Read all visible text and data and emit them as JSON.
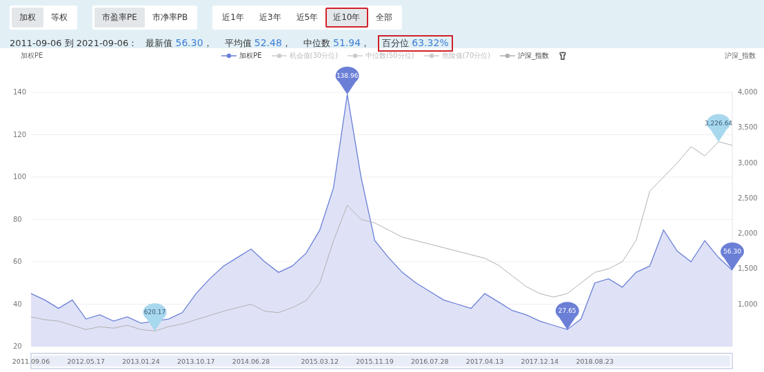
{
  "weight_tabs": [
    {
      "label": "加权",
      "selected": true
    },
    {
      "label": "等权",
      "selected": false
    }
  ],
  "metric_tabs": [
    {
      "label": "市盈率PE",
      "selected": true
    },
    {
      "label": "市净率PB",
      "selected": false
    }
  ],
  "period_tabs": [
    {
      "label": "近1年",
      "selected": false
    },
    {
      "label": "近3年",
      "selected": false
    },
    {
      "label": "近5年",
      "selected": false
    },
    {
      "label": "近10年",
      "selected": true
    },
    {
      "label": "全部",
      "selected": false
    }
  ],
  "summary": {
    "range": "2011-09-06 到 2021-09-06：",
    "stats": [
      {
        "label": "最新值",
        "value": "56.30",
        "sep": "，",
        "highlighted": false
      },
      {
        "label": "平均值",
        "value": "52.48",
        "sep": "，",
        "highlighted": false
      },
      {
        "label": "中位数",
        "value": "51.94",
        "sep": "，",
        "highlighted": false
      },
      {
        "label": "百分位",
        "value": "63.32%",
        "highlighted": true
      }
    ]
  },
  "chart": {
    "left_axis_title": "加权PE",
    "right_axis_title": "沪深_指数",
    "legend": [
      {
        "kind": "series",
        "selected": true
      },
      {
        "kind": "level",
        "label": "机会值(30分位)",
        "selected": false
      },
      {
        "kind": "level",
        "label": "中位数(50分位)",
        "selected": false
      },
      {
        "kind": "level",
        "label": "危险值(70分位)",
        "selected": false
      },
      {
        "kind": "series",
        "selected": true
      }
    ],
    "markers": [
      {
        "kind": "high",
        "overlay": false,
        "label": "138.96"
      },
      {
        "kind": "low",
        "overlay": false,
        "label": "27.65"
      },
      {
        "kind": "low",
        "overlay": true,
        "label": "620.17"
      },
      {
        "kind": "high",
        "overlay": true,
        "label": "3,226.64"
      },
      {
        "kind": "last",
        "overlay": false,
        "label": "56.30"
      }
    ],
    "zoom_slider": {
      "level": 1
    },
    "layers": [
      {
        "chart_data": {
          "type": "area",
          "grid": true,
          "categories": [
            "2011.09.06",
            null,
            null,
            null,
            "2012.05.17",
            null,
            null,
            null,
            "2013.01.24",
            null,
            null,
            null,
            "2013.10.17",
            null,
            null,
            null,
            "2014.06.28",
            null,
            null,
            null,
            null,
            "2015.03.12",
            null,
            null,
            null,
            "2015.11.19",
            null,
            null,
            null,
            "2016.07.28",
            null,
            null,
            null,
            "2017.04.13",
            null,
            null,
            null,
            "2017.12.14",
            null,
            null,
            null,
            "2018.08.23",
            null,
            null,
            null,
            null,
            null,
            null,
            null,
            null,
            null,
            null
          ],
          "ylim": [
            20,
            140
          ],
          "yticks": [
            20,
            40,
            60,
            80,
            100,
            120,
            140
          ],
          "series": [
            {
              "name": "加权PE",
              "color": "#6a7fd8",
              "values": [
                45,
                42,
                38,
                42,
                33,
                35,
                32,
                34,
                31,
                null,
                33,
                36,
                45,
                52,
                58,
                62,
                66,
                60,
                55,
                58,
                64,
                75,
                95,
                139,
                100,
                70,
                62,
                55,
                50,
                46,
                42,
                40,
                38,
                45,
                41,
                37,
                35,
                32,
                30,
                28,
                33,
                50,
                52,
                48,
                55,
                58,
                75,
                65,
                60,
                70,
                62,
                56
              ]
            }
          ]
        }
      },
      {
        "chart_data": {
          "type": "line",
          "ylim": [
            400,
            4000
          ],
          "yticks": [
            {
              "value": 1000,
              "label": "1,000"
            },
            {
              "value": 1500,
              "label": "1,500"
            },
            {
              "value": 2000,
              "label": "2,000"
            },
            {
              "value": 2500,
              "label": "2,500"
            },
            {
              "value": 3000,
              "label": "3,000"
            },
            {
              "value": 3500,
              "label": "3,500"
            },
            {
              "value": 4000,
              "label": "4,000"
            }
          ],
          "series": [
            {
              "name": "沪深_指数",
              "color": "#b0b0b0",
              "values": [
                820,
                780,
                760,
                700,
                640,
                680,
                660,
                700,
                640,
                620,
                680,
                720,
                780,
                840,
                900,
                950,
                1000,
                900,
                880,
                950,
                1050,
                1300,
                1900,
                2400,
                2200,
                2150,
                2050,
                1950,
                1900,
                1850,
                1800,
                1750,
                1700,
                1650,
                1550,
                1400,
                1250,
                1150,
                1100,
                1150,
                1300,
                1450,
                1500,
                1600,
                1900,
                2600,
                2800,
                3000,
                3230,
                3100,
                3300,
                3250
              ]
            }
          ]
        }
      }
    ]
  }
}
